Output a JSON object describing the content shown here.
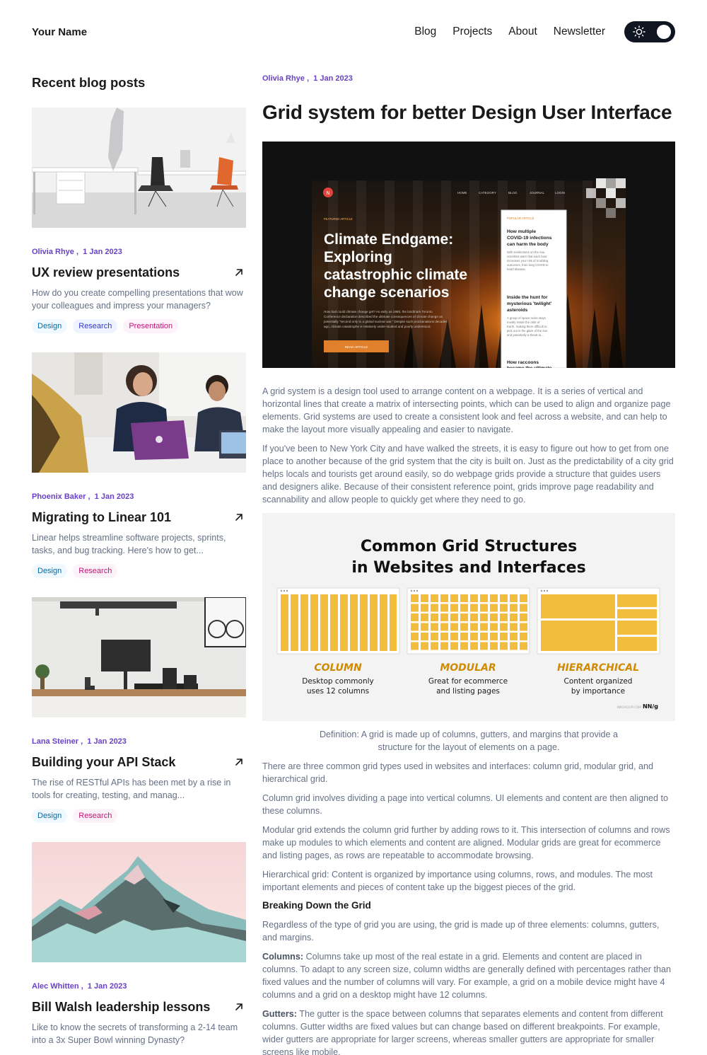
{
  "header": {
    "brand": "Your Name",
    "nav": [
      "Blog",
      "Projects",
      "About",
      "Newsletter"
    ],
    "theme_toggle_icon": "sun-icon"
  },
  "sidebar": {
    "heading": "Recent blog posts",
    "posts": [
      {
        "author": "Olivia Rhye",
        "date": "1 Jan 2023",
        "title": "UX review presentations",
        "excerpt": "How do you create compelling presentations that wow your colleagues and impress your managers?",
        "tags": [
          "Design",
          "Research",
          "Presentation"
        ]
      },
      {
        "author": "Phoenix Baker",
        "date": "1 Jan 2023",
        "title": "Migrating to Linear 101",
        "excerpt": "Linear helps streamline software projects, sprints, tasks, and bug tracking. Here's how to get...",
        "tags": [
          "Design",
          "Research"
        ]
      },
      {
        "author": "Lana Steiner",
        "date": "1 Jan 2023",
        "title": "Building your API Stack",
        "excerpt": "The rise of RESTful APIs has been met by a rise in tools for creating, testing, and manag...",
        "tags": [
          "Design",
          "Research"
        ]
      },
      {
        "author": "Alec Whitten",
        "date": "1 Jan 2023",
        "title": "Bill Walsh leadership lessons",
        "excerpt": "Like to know the secrets of transforming a 2-14 team into a 3x Super Bowl winning Dynasty?",
        "tags": []
      }
    ]
  },
  "article": {
    "author": "Olivia Rhye",
    "date": "1 Jan 2023",
    "title": "Grid system for better Design User Interface",
    "hero": {
      "menu": [
        "HOME",
        "CATEGORY",
        "BLOG",
        "JOURNAL",
        "LOGIN"
      ],
      "featured_label": "FEATURED ARTICLE",
      "headline": "Climate Endgame: Exploring catastrophic climate change scenarios",
      "body": "How bad could climate change get? As early as 1988, the landmark Toronto Conference declaration described the ultimate consequences of climate change as potentially \"second only to a global nuclear war.\" Despite such proclamations decades ago, climate catastrophe is relatively under-studied and poorly understood.",
      "cta": "READ ARTICLE",
      "popular_label": "POPULAR ARTICLE",
      "popular_1_title": "How multiple COVID-19 infections can harm the body",
      "popular_1_text": "With reinfections on the rise, scientists warn that each bout increases your risk of troubling outcomes, from long COVID to heart disease.",
      "popular_2_title": "Inside the hunt for mysterious 'twilight' asteroids",
      "popular_2_text": "A group of space rocks stays mostly inside the orbit of Earth, making them difficult to pick out in the glare of the sun and potentially a threat to...",
      "popular_3_title": "How raccoons became the ultimate..."
    },
    "p1": "A grid system is a design tool used to arrange content on a webpage. It is a series of vertical and horizontal lines that create a matrix of intersecting points, which can be used to align and organize page elements. Grid systems are used to create a consistent look and feel across a website, and can help to make the layout more visually appealing and easier to navigate.",
    "p2": "If you've been to New York City and have walked the streets, it is easy to figure out how to get from one place to another because of the grid system that the city is built on. Just as the predictability of a city grid helps locals and tourists get around easily, so do webpage grids provide a structure that guides users and designers alike. Because of their consistent reference point, grids improve page readability and scannability and allow people to quickly get where they need to go.",
    "figure": {
      "title_line1": "Common Grid Structures",
      "title_line2": "in Websites and Interfaces",
      "items": [
        {
          "name": "COLUMN",
          "desc1": "Desktop commonly",
          "desc2": "uses 12 columns"
        },
        {
          "name": "MODULAR",
          "desc1": "Great for ecommerce",
          "desc2": "and listing pages"
        },
        {
          "name": "HIERARCHICAL",
          "desc1": "Content organized",
          "desc2": "by importance"
        }
      ],
      "source": "NNGROUP.COM",
      "logo": "NN/g"
    },
    "caption": "Definition: A grid is made up of columns, gutters, and margins that provide a structure for the layout of elements on a page.",
    "p3": "There are three common grid types used in websites and interfaces: column grid, modular grid, and hierarchical grid.",
    "p4": "Column grid involves dividing a page into vertical columns. UI elements and content are then aligned to these columns.",
    "p5": "Modular grid extends the column grid further by adding rows to it. This intersection of columns and rows make up modules to which elements and content are aligned. Modular grids are great for ecommerce and listing pages, as rows are repeatable to accommodate browsing.",
    "p6": "Hierarchical grid: Content is organized by importance using columns, rows, and modules. The most important elements and pieces of content take up the biggest pieces of the grid.",
    "subhead": "Breaking Down the Grid",
    "p7": "Regardless of the type of grid you are using, the grid is made up of three elements: columns, gutters, and margins.",
    "p8_label": "Columns:",
    "p8": " Columns take up most of the real estate in a grid. Elements and content are placed in columns. To adapt to any screen size, column widths are generally defined with percentages rather than fixed values and the number of columns will vary. For example, a grid on a mobile device might have 4 columns and a grid on a desktop might have 12 columns.",
    "p9_label": "Gutters:",
    "p9": " The gutter is the space between columns that separates elements and content from different columns. Gutter widths are fixed values but can change based on different breakpoints. For example, wider gutters are appropriate for larger screens, whereas smaller gutters are appropriate for smaller screens like mobile."
  },
  "colors": {
    "accent": "#6941c6",
    "text": "#1a1a1a",
    "muted": "#667085",
    "toggle_bg": "#0f1521",
    "grid_yellow": "#f2bd3c",
    "grid_label": "#d08a00"
  }
}
